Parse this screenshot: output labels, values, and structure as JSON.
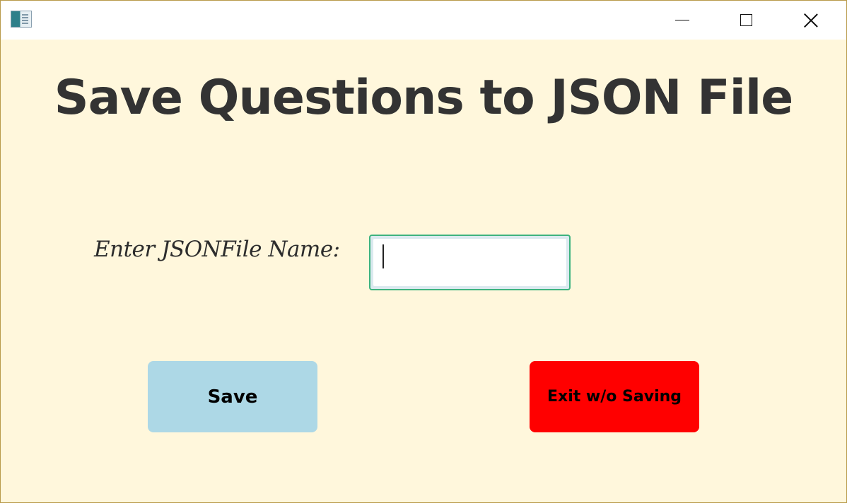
{
  "window": {
    "controls": [
      "minimize",
      "maximize",
      "close"
    ]
  },
  "main": {
    "title": "Save Questions to JSON File",
    "file_label": "Enter JSONFile Name:",
    "file_input_value": "",
    "save_label": "Save",
    "exit_label": "Exit w/o Saving"
  },
  "colors": {
    "background": "#fff7dc",
    "save_button": "#add8e6",
    "exit_button": "#ff0000",
    "input_focus_border": "#3db37f",
    "title_text": "#333333"
  },
  "icons": {
    "app": "app-window-icon",
    "minimize": "minimize-icon",
    "maximize": "maximize-icon",
    "close": "close-icon"
  }
}
